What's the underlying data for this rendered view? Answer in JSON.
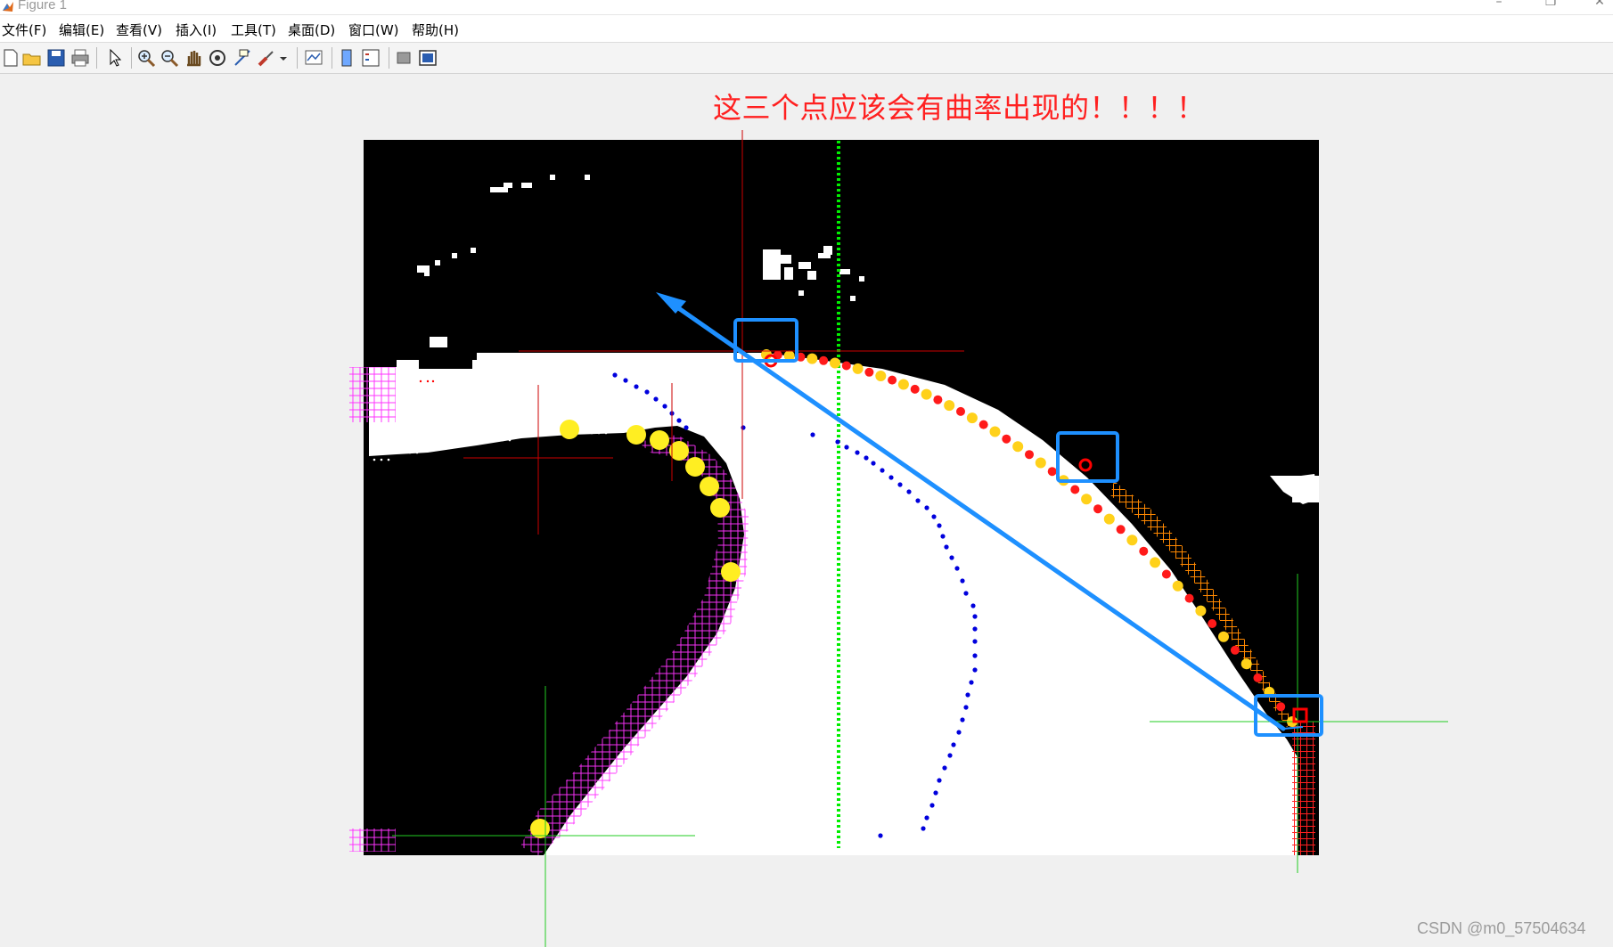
{
  "window": {
    "title": "Figure 1",
    "minimize_icon": "minimize-icon",
    "restore_icon": "restore-icon",
    "close_icon": "close-icon"
  },
  "menubar": {
    "items": [
      "文件(F)",
      "编辑(E)",
      "查看(V)",
      "插入(I)",
      "工具(T)",
      "桌面(D)",
      "窗口(W)",
      "帮助(H)"
    ]
  },
  "toolbar": {
    "icons": [
      "new-figure-icon",
      "open-file-icon",
      "save-icon",
      "print-icon",
      "pointer-icon",
      "zoom-in-icon",
      "zoom-out-icon",
      "pan-icon",
      "rotate-3d-icon",
      "data-cursor-icon",
      "brush-icon",
      "brush-dropdown-icon",
      "link-plot-icon",
      "insert-colorbar-icon",
      "insert-legend-icon",
      "hide-plot-tools-icon",
      "show-plot-tools-icon"
    ]
  },
  "annotation": {
    "text": "这三个点应该会有曲率出现的！！！！",
    "color": "#ff2020",
    "arrow_color": "#1e90ff",
    "box_color": "#1e90ff"
  },
  "figure": {
    "image_description_colors": {
      "background": "#000000",
      "road": "#ffffff",
      "marker_green": "#00ff00",
      "marker_red": "#ff0000",
      "marker_yellow": "#ffee22",
      "marker_magenta": "#ff33ff",
      "marker_blue": "#0000dd"
    }
  },
  "watermark": {
    "text": "CSDN @m0_57504634"
  }
}
